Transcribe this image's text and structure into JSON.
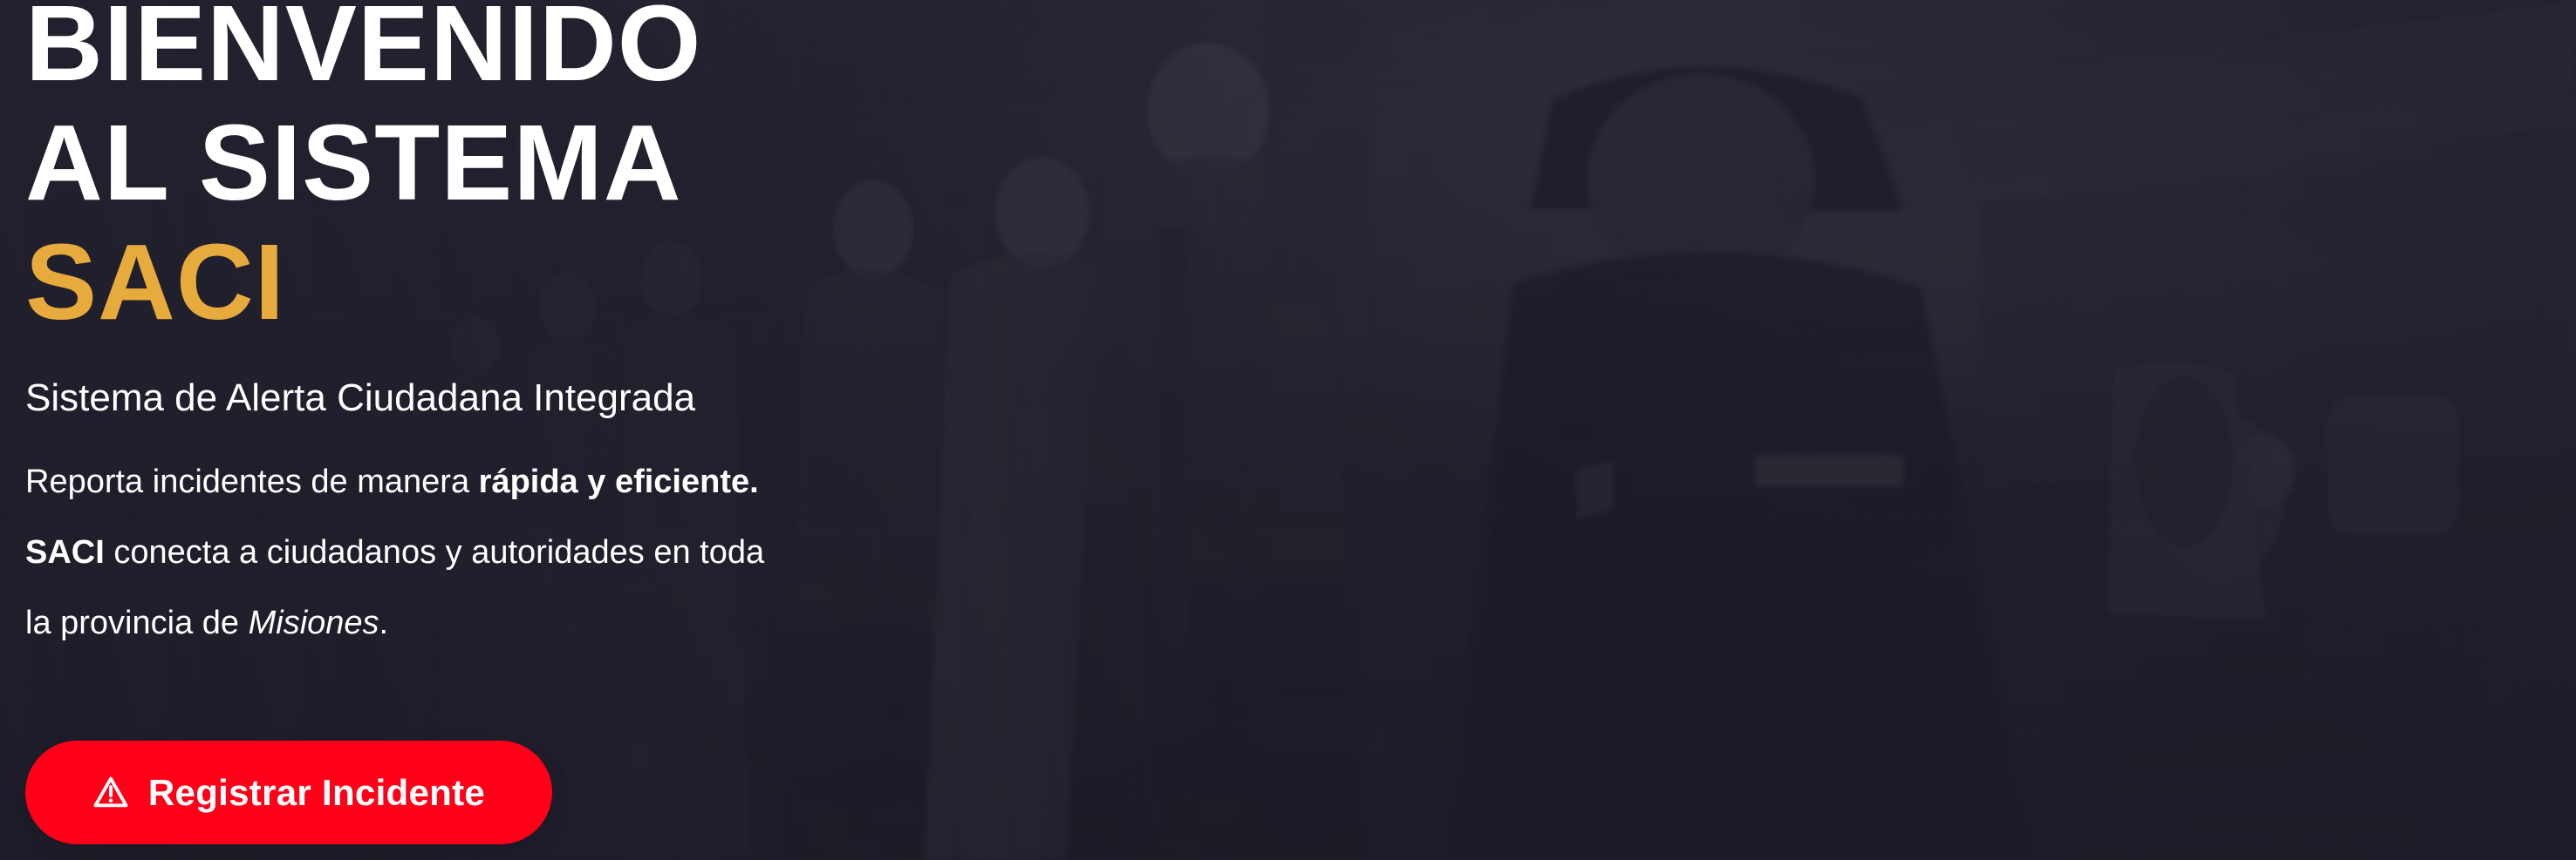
{
  "hero": {
    "title_line_1": "BIENVENIDO",
    "title_line_2": "AL SISTEMA",
    "title_line_3": "SACI",
    "subtitle": "Sistema de Alerta Ciudadana Integrada",
    "description": {
      "line_1_prefix": "Reporta incidentes de manera ",
      "line_1_emphasis": "rápida y eficiente.",
      "line_2_emphasis": "SACI",
      "line_2_suffix": " conecta a ciudadanos y autoridades en toda",
      "line_3_prefix": "la provincia de ",
      "line_3_emphasis": "Misiones",
      "line_3_suffix": "."
    },
    "cta_label": "Registrar Incidente",
    "cta_icon": "warning-icon"
  },
  "colors": {
    "background": "#22212e",
    "title": "#ffffff",
    "accent": "#e7aa3d",
    "button": "#ff0018",
    "button_text": "#ffffff"
  }
}
